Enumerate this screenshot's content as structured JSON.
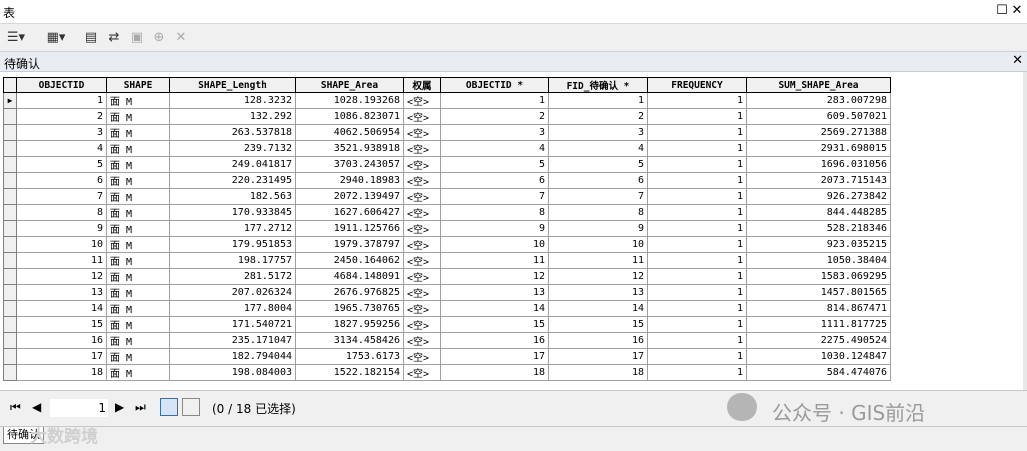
{
  "window": {
    "title": "表"
  },
  "tab": {
    "label": "待确认"
  },
  "columns": [
    "OBJECTID",
    "SHAPE",
    "SHAPE_Length",
    "SHAPE_Area",
    "权属",
    "OBJECTID *",
    "FID_待确认 *",
    "FREQUENCY",
    "SUM_SHAPE_Area"
  ],
  "rows": [
    [
      "1",
      "面 M",
      "128.3232",
      "1028.193268",
      "<空>",
      "1",
      "1",
      "1",
      "283.007298"
    ],
    [
      "2",
      "面 M",
      "132.292",
      "1086.823071",
      "<空>",
      "2",
      "2",
      "1",
      "609.507021"
    ],
    [
      "3",
      "面 M",
      "263.537818",
      "4062.506954",
      "<空>",
      "3",
      "3",
      "1",
      "2569.271388"
    ],
    [
      "4",
      "面 M",
      "239.7132",
      "3521.938918",
      "<空>",
      "4",
      "4",
      "1",
      "2931.698015"
    ],
    [
      "5",
      "面 M",
      "249.041817",
      "3703.243057",
      "<空>",
      "5",
      "5",
      "1",
      "1696.031056"
    ],
    [
      "6",
      "面 M",
      "220.231495",
      "2940.18983",
      "<空>",
      "6",
      "6",
      "1",
      "2073.715143"
    ],
    [
      "7",
      "面 M",
      "182.563",
      "2072.139497",
      "<空>",
      "7",
      "7",
      "1",
      "926.273842"
    ],
    [
      "8",
      "面 M",
      "170.933845",
      "1627.606427",
      "<空>",
      "8",
      "8",
      "1",
      "844.448285"
    ],
    [
      "9",
      "面 M",
      "177.2712",
      "1911.125766",
      "<空>",
      "9",
      "9",
      "1",
      "528.218346"
    ],
    [
      "10",
      "面 M",
      "179.951853",
      "1979.378797",
      "<空>",
      "10",
      "10",
      "1",
      "923.035215"
    ],
    [
      "11",
      "面 M",
      "198.17757",
      "2450.164062",
      "<空>",
      "11",
      "11",
      "1",
      "1050.38404"
    ],
    [
      "12",
      "面 M",
      "281.5172",
      "4684.148091",
      "<空>",
      "12",
      "12",
      "1",
      "1583.069295"
    ],
    [
      "13",
      "面 M",
      "207.026324",
      "2676.976825",
      "<空>",
      "13",
      "13",
      "1",
      "1457.801565"
    ],
    [
      "14",
      "面 M",
      "177.8004",
      "1965.730765",
      "<空>",
      "14",
      "14",
      "1",
      "814.867471"
    ],
    [
      "15",
      "面 M",
      "171.540721",
      "1827.959256",
      "<空>",
      "15",
      "15",
      "1",
      "1111.817725"
    ],
    [
      "16",
      "面 M",
      "235.171047",
      "3134.458426",
      "<空>",
      "16",
      "16",
      "1",
      "2275.490524"
    ],
    [
      "17",
      "面 M",
      "182.794044",
      "1753.6173",
      "<空>",
      "17",
      "17",
      "1",
      "1030.124847"
    ],
    [
      "18",
      "面 M",
      "198.084003",
      "1522.182154",
      "<空>",
      "18",
      "18",
      "1",
      "584.474076"
    ]
  ],
  "nav": {
    "current_record": "1",
    "status": "(0 / 18 已选择)"
  },
  "bottom_tab": {
    "label": "待确认"
  },
  "watermarks": {
    "right": "公众号 · GIS前沿",
    "left": "大数跨境"
  }
}
